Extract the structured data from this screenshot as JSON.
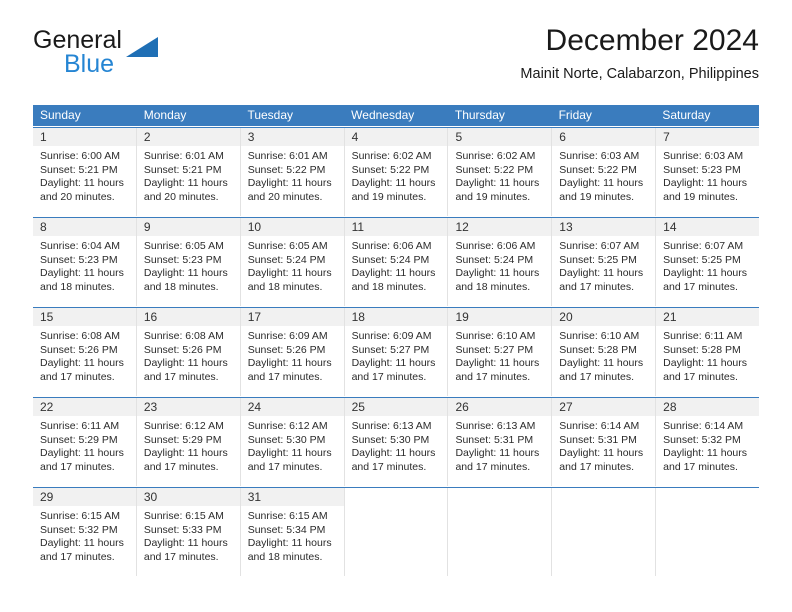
{
  "brand": {
    "name_part1": "General",
    "name_part2": "Blue",
    "triangle_color": "#1f6fb5",
    "blue_color": "#2585d3"
  },
  "header": {
    "title": "December 2024",
    "subtitle": "Mainit Norte, Calabarzon, Philippines"
  },
  "theme": {
    "header_bg": "#3a7cbe",
    "header_text": "#ffffff",
    "daynum_strip_bg": "#f1f1f1",
    "cell_bg": "#ffffff",
    "grid_line": "#e2e2e2"
  },
  "weekdays": [
    "Sunday",
    "Monday",
    "Tuesday",
    "Wednesday",
    "Thursday",
    "Friday",
    "Saturday"
  ],
  "weeks": [
    [
      {
        "day": "1",
        "sunrise": "Sunrise: 6:00 AM",
        "sunset": "Sunset: 5:21 PM",
        "daylight1": "Daylight: 11 hours",
        "daylight2": "and 20 minutes."
      },
      {
        "day": "2",
        "sunrise": "Sunrise: 6:01 AM",
        "sunset": "Sunset: 5:21 PM",
        "daylight1": "Daylight: 11 hours",
        "daylight2": "and 20 minutes."
      },
      {
        "day": "3",
        "sunrise": "Sunrise: 6:01 AM",
        "sunset": "Sunset: 5:22 PM",
        "daylight1": "Daylight: 11 hours",
        "daylight2": "and 20 minutes."
      },
      {
        "day": "4",
        "sunrise": "Sunrise: 6:02 AM",
        "sunset": "Sunset: 5:22 PM",
        "daylight1": "Daylight: 11 hours",
        "daylight2": "and 19 minutes."
      },
      {
        "day": "5",
        "sunrise": "Sunrise: 6:02 AM",
        "sunset": "Sunset: 5:22 PM",
        "daylight1": "Daylight: 11 hours",
        "daylight2": "and 19 minutes."
      },
      {
        "day": "6",
        "sunrise": "Sunrise: 6:03 AM",
        "sunset": "Sunset: 5:22 PM",
        "daylight1": "Daylight: 11 hours",
        "daylight2": "and 19 minutes."
      },
      {
        "day": "7",
        "sunrise": "Sunrise: 6:03 AM",
        "sunset": "Sunset: 5:23 PM",
        "daylight1": "Daylight: 11 hours",
        "daylight2": "and 19 minutes."
      }
    ],
    [
      {
        "day": "8",
        "sunrise": "Sunrise: 6:04 AM",
        "sunset": "Sunset: 5:23 PM",
        "daylight1": "Daylight: 11 hours",
        "daylight2": "and 18 minutes."
      },
      {
        "day": "9",
        "sunrise": "Sunrise: 6:05 AM",
        "sunset": "Sunset: 5:23 PM",
        "daylight1": "Daylight: 11 hours",
        "daylight2": "and 18 minutes."
      },
      {
        "day": "10",
        "sunrise": "Sunrise: 6:05 AM",
        "sunset": "Sunset: 5:24 PM",
        "daylight1": "Daylight: 11 hours",
        "daylight2": "and 18 minutes."
      },
      {
        "day": "11",
        "sunrise": "Sunrise: 6:06 AM",
        "sunset": "Sunset: 5:24 PM",
        "daylight1": "Daylight: 11 hours",
        "daylight2": "and 18 minutes."
      },
      {
        "day": "12",
        "sunrise": "Sunrise: 6:06 AM",
        "sunset": "Sunset: 5:24 PM",
        "daylight1": "Daylight: 11 hours",
        "daylight2": "and 18 minutes."
      },
      {
        "day": "13",
        "sunrise": "Sunrise: 6:07 AM",
        "sunset": "Sunset: 5:25 PM",
        "daylight1": "Daylight: 11 hours",
        "daylight2": "and 17 minutes."
      },
      {
        "day": "14",
        "sunrise": "Sunrise: 6:07 AM",
        "sunset": "Sunset: 5:25 PM",
        "daylight1": "Daylight: 11 hours",
        "daylight2": "and 17 minutes."
      }
    ],
    [
      {
        "day": "15",
        "sunrise": "Sunrise: 6:08 AM",
        "sunset": "Sunset: 5:26 PM",
        "daylight1": "Daylight: 11 hours",
        "daylight2": "and 17 minutes."
      },
      {
        "day": "16",
        "sunrise": "Sunrise: 6:08 AM",
        "sunset": "Sunset: 5:26 PM",
        "daylight1": "Daylight: 11 hours",
        "daylight2": "and 17 minutes."
      },
      {
        "day": "17",
        "sunrise": "Sunrise: 6:09 AM",
        "sunset": "Sunset: 5:26 PM",
        "daylight1": "Daylight: 11 hours",
        "daylight2": "and 17 minutes."
      },
      {
        "day": "18",
        "sunrise": "Sunrise: 6:09 AM",
        "sunset": "Sunset: 5:27 PM",
        "daylight1": "Daylight: 11 hours",
        "daylight2": "and 17 minutes."
      },
      {
        "day": "19",
        "sunrise": "Sunrise: 6:10 AM",
        "sunset": "Sunset: 5:27 PM",
        "daylight1": "Daylight: 11 hours",
        "daylight2": "and 17 minutes."
      },
      {
        "day": "20",
        "sunrise": "Sunrise: 6:10 AM",
        "sunset": "Sunset: 5:28 PM",
        "daylight1": "Daylight: 11 hours",
        "daylight2": "and 17 minutes."
      },
      {
        "day": "21",
        "sunrise": "Sunrise: 6:11 AM",
        "sunset": "Sunset: 5:28 PM",
        "daylight1": "Daylight: 11 hours",
        "daylight2": "and 17 minutes."
      }
    ],
    [
      {
        "day": "22",
        "sunrise": "Sunrise: 6:11 AM",
        "sunset": "Sunset: 5:29 PM",
        "daylight1": "Daylight: 11 hours",
        "daylight2": "and 17 minutes."
      },
      {
        "day": "23",
        "sunrise": "Sunrise: 6:12 AM",
        "sunset": "Sunset: 5:29 PM",
        "daylight1": "Daylight: 11 hours",
        "daylight2": "and 17 minutes."
      },
      {
        "day": "24",
        "sunrise": "Sunrise: 6:12 AM",
        "sunset": "Sunset: 5:30 PM",
        "daylight1": "Daylight: 11 hours",
        "daylight2": "and 17 minutes."
      },
      {
        "day": "25",
        "sunrise": "Sunrise: 6:13 AM",
        "sunset": "Sunset: 5:30 PM",
        "daylight1": "Daylight: 11 hours",
        "daylight2": "and 17 minutes."
      },
      {
        "day": "26",
        "sunrise": "Sunrise: 6:13 AM",
        "sunset": "Sunset: 5:31 PM",
        "daylight1": "Daylight: 11 hours",
        "daylight2": "and 17 minutes."
      },
      {
        "day": "27",
        "sunrise": "Sunrise: 6:14 AM",
        "sunset": "Sunset: 5:31 PM",
        "daylight1": "Daylight: 11 hours",
        "daylight2": "and 17 minutes."
      },
      {
        "day": "28",
        "sunrise": "Sunrise: 6:14 AM",
        "sunset": "Sunset: 5:32 PM",
        "daylight1": "Daylight: 11 hours",
        "daylight2": "and 17 minutes."
      }
    ],
    [
      {
        "day": "29",
        "sunrise": "Sunrise: 6:15 AM",
        "sunset": "Sunset: 5:32 PM",
        "daylight1": "Daylight: 11 hours",
        "daylight2": "and 17 minutes."
      },
      {
        "day": "30",
        "sunrise": "Sunrise: 6:15 AM",
        "sunset": "Sunset: 5:33 PM",
        "daylight1": "Daylight: 11 hours",
        "daylight2": "and 17 minutes."
      },
      {
        "day": "31",
        "sunrise": "Sunrise: 6:15 AM",
        "sunset": "Sunset: 5:34 PM",
        "daylight1": "Daylight: 11 hours",
        "daylight2": "and 18 minutes."
      },
      {
        "day": "",
        "sunrise": "",
        "sunset": "",
        "daylight1": "",
        "daylight2": ""
      },
      {
        "day": "",
        "sunrise": "",
        "sunset": "",
        "daylight1": "",
        "daylight2": ""
      },
      {
        "day": "",
        "sunrise": "",
        "sunset": "",
        "daylight1": "",
        "daylight2": ""
      },
      {
        "day": "",
        "sunrise": "",
        "sunset": "",
        "daylight1": "",
        "daylight2": ""
      }
    ]
  ]
}
